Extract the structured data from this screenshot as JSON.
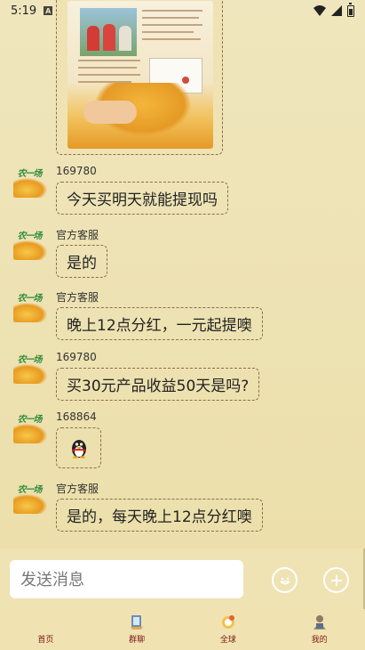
{
  "status_bar": {
    "time": "5:19",
    "sim_label": "A"
  },
  "messages": [
    {
      "sender": "169780",
      "text": "今天买明天就能提现吗",
      "type": "text"
    },
    {
      "sender": "官方客服",
      "text": "是的",
      "type": "text"
    },
    {
      "sender": "官方客服",
      "text": "晚上12点分红，一元起提噢",
      "type": "text"
    },
    {
      "sender": "169780",
      "text": "买30元产品收益50天是吗?",
      "type": "text"
    },
    {
      "sender": "168864",
      "text": "",
      "type": "sticker"
    },
    {
      "sender": "官方客服",
      "text": "是的，每天晚上12点分红噢",
      "type": "text"
    }
  ],
  "avatar_logo_text": "农一场",
  "input": {
    "placeholder": "发送消息"
  },
  "tabs": [
    {
      "label": "首页",
      "icon": "home-icon"
    },
    {
      "label": "群聊",
      "icon": "group-chat-icon"
    },
    {
      "label": "全球",
      "icon": "globe-icon"
    },
    {
      "label": "我的",
      "icon": "profile-icon"
    }
  ],
  "colors": {
    "background": "#efe3b4",
    "bubble_border": "#8d6e4a",
    "tab_label": "#7a1a1a"
  }
}
